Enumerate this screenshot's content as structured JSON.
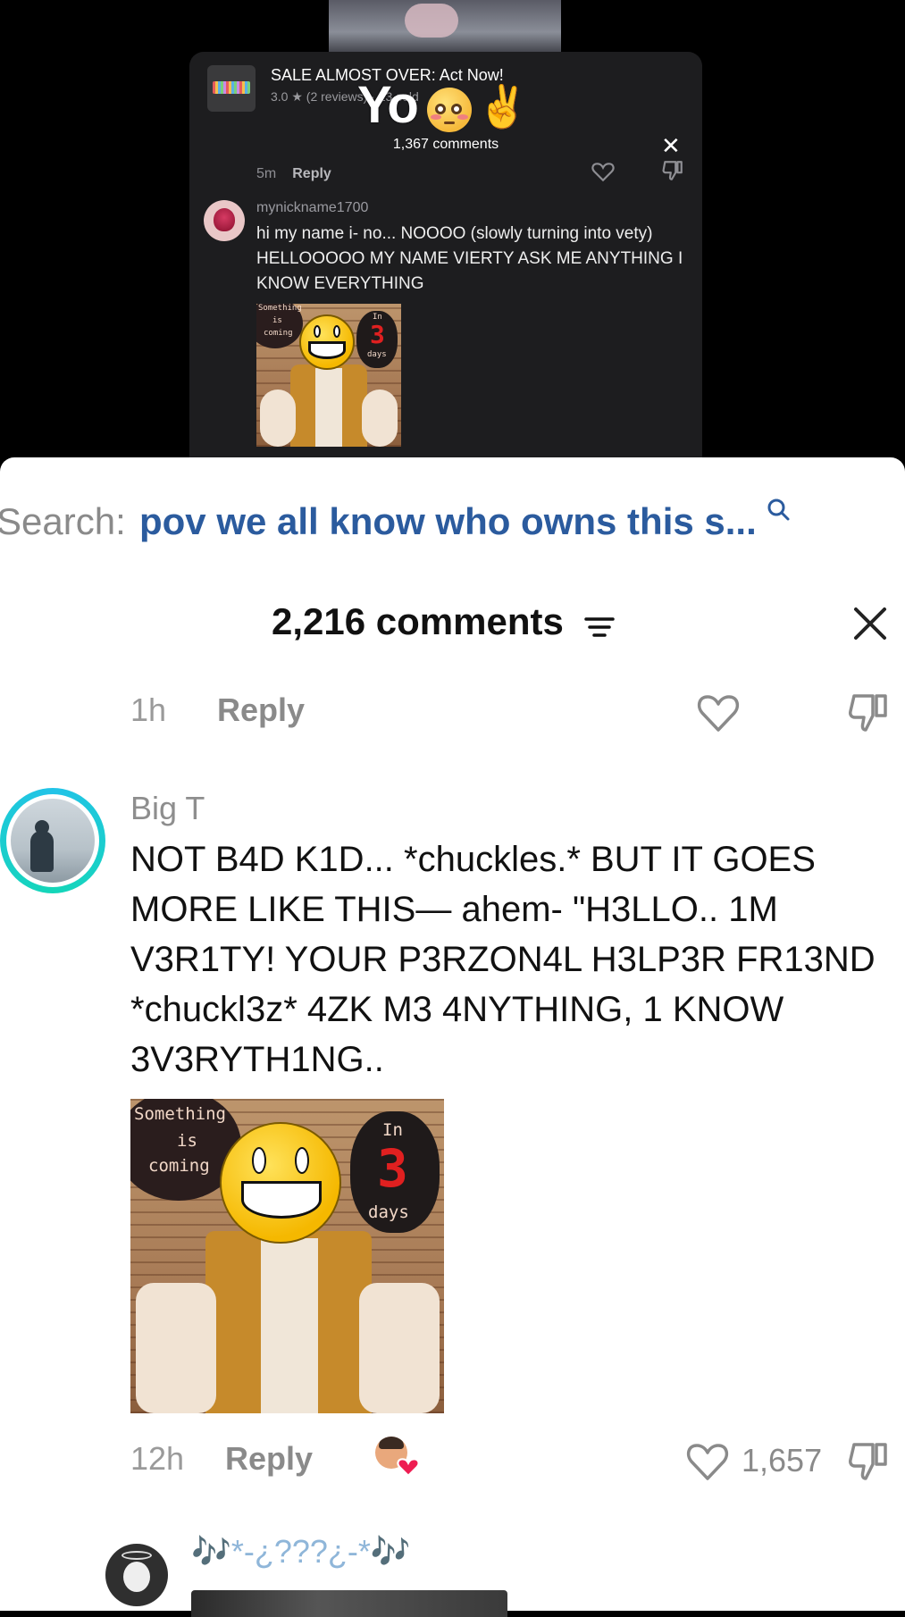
{
  "embedded": {
    "ad_title": "SALE ALMOST OVER: Act Now!",
    "ad_subtitle": "3.0 ★ (2 reviews) · 13 sold",
    "overlay_text": "Yo",
    "overlay_emoji": [
      "flushed-face",
      "victory-hand"
    ],
    "comments_count": "1,367 comments",
    "meta_time": "5m",
    "meta_reply": "Reply",
    "comment": {
      "user": "mynickname1700",
      "text": "hi my name i- no... NOOOO (slowly turning into vety) HELLOOOOO MY NAME VIERTY ASK ME ANYTHING I KNOW EVERYTHING"
    }
  },
  "meme_image": {
    "left_text_1": "Something",
    "left_text_2": "is",
    "left_text_3": "coming",
    "right_text_1": "In",
    "right_number": "3",
    "right_text_2": "days"
  },
  "search": {
    "label": "Search:",
    "query": "pov we all know who owns this s..."
  },
  "header": {
    "comments_count": "2,216 comments"
  },
  "prev_row": {
    "time": "1h",
    "reply": "Reply"
  },
  "main_comment": {
    "user": "Big T",
    "text": "NOT B4D K1D... *chuckles.* BUT IT GOES MORE LIKE THIS— ahem- \"H3LLO.. 1M V3R1TY! YOUR P3RZON4L H3LP3R FR13ND *chuckl3z* 4ZK M3 4NYTHING, 1 KNOW 3V3RYTH1NG..",
    "time": "12h",
    "reply": "Reply",
    "likes": "1,657"
  },
  "next_comment": {
    "user": "🎶*-¿???¿-*🎶"
  },
  "colors": {
    "accent_search": "#2b5b9e",
    "story_ring": "#22c3e8",
    "liked_heart": "#ee1d52"
  }
}
